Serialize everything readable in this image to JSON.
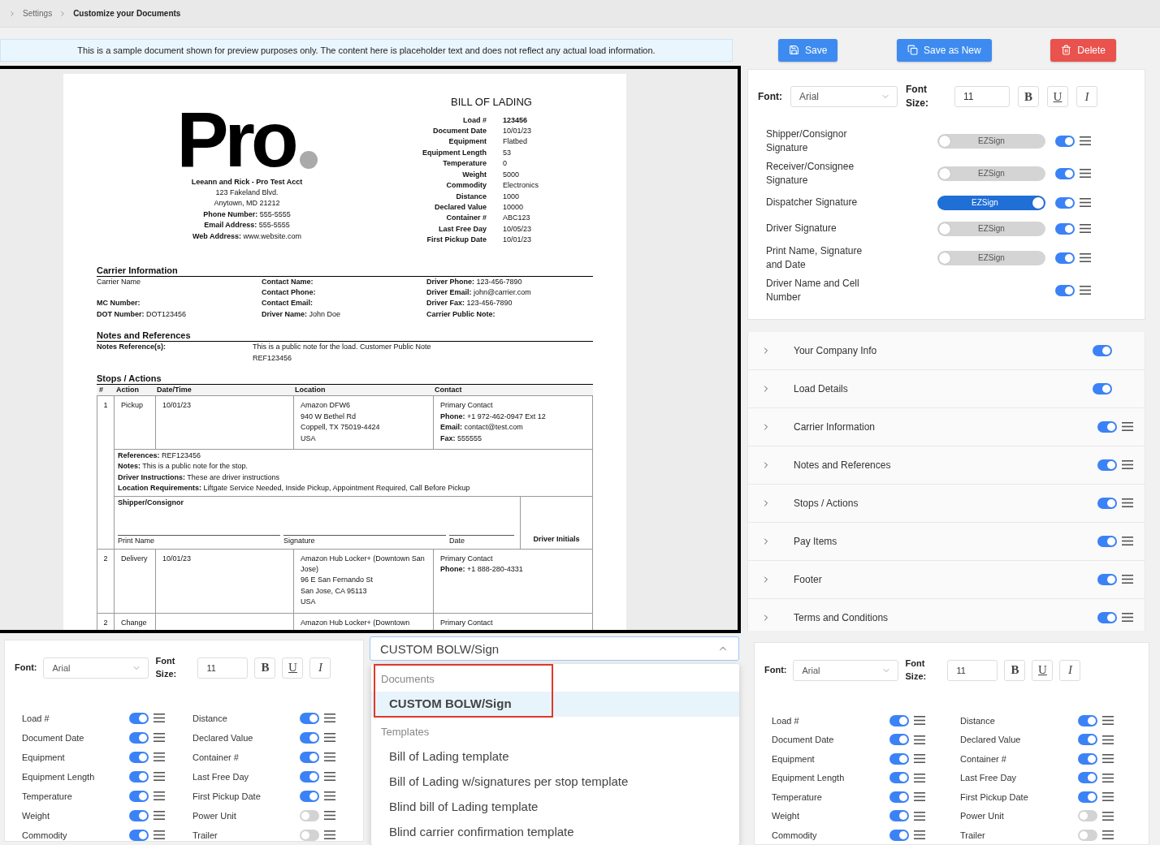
{
  "breadcrumb": [
    {
      "label": "Settings",
      "current": false
    },
    {
      "label": "Customize your Documents",
      "current": true
    }
  ],
  "notice": "This is a sample document shown for preview purposes only. The content here is placeholder text and does not reflect any actual load information.",
  "document": {
    "logo": "Pro",
    "company": {
      "name": "Leeann and Rick - Pro Test Acct",
      "lines": [
        "123 Fakeland Blvd.",
        "Anytown, MD 21212",
        "**Phone Number:** 555-5555",
        "**Email Address:** 555-5555",
        "**Web Address:** www.website.com"
      ]
    },
    "title": "BILL OF LADING",
    "details": [
      {
        "label": "Load #",
        "value": "123456",
        "bold": true
      },
      {
        "label": "Document Date",
        "value": "10/01/23",
        "bold": false
      },
      {
        "label": "Equipment",
        "value": "Flatbed",
        "bold": false
      },
      {
        "label": "Equipment Length",
        "value": "53",
        "bold": false
      },
      {
        "label": "Temperature",
        "value": "0",
        "bold": false
      },
      {
        "label": "Weight",
        "value": "5000",
        "bold": false
      },
      {
        "label": "Commodity",
        "value": "Electronics",
        "bold": false
      },
      {
        "label": "Distance",
        "value": "1000",
        "bold": false
      },
      {
        "label": "Declared Value",
        "value": "10000",
        "bold": false
      },
      {
        "label": "Container #",
        "value": "ABC123",
        "bold": false
      },
      {
        "label": "Last Free Day",
        "value": "10/05/23",
        "bold": false
      },
      {
        "label": "First Pickup Date",
        "value": "10/01/23",
        "bold": false
      }
    ],
    "carrier": {
      "title": "Carrier Information",
      "rows": [
        [
          "Carrier Name",
          "**Contact Name:**",
          "**Driver Phone:** 123-456-7890"
        ],
        [
          null,
          "**Contact Phone:**",
          "**Driver Email:** john@carrier.com"
        ],
        [
          "**MC Number:**",
          "**Contact Email:**",
          "**Driver Fax:** 123-456-7890"
        ],
        [
          "**DOT Number:** DOT123456",
          "**Driver Name:** John Doe",
          "**Carrier Public Note:**"
        ]
      ]
    },
    "notes": {
      "title": "Notes and References",
      "label": "Notes Reference(s):",
      "lines": [
        "This is a public note for the load. Customer Public Note",
        "REF123456"
      ]
    },
    "stops": {
      "title": "Stops / Actions",
      "columns": [
        "#",
        "Action",
        "Date/Time",
        "Location",
        "Contact"
      ],
      "rows": [
        {
          "number": "1",
          "action": "Pickup",
          "date": "10/01/23",
          "location": [
            "Amazon DFW6",
            "940 W Bethel Rd",
            "Coppell, TX 75019-4424",
            "USA"
          ],
          "contact": [
            "Primary Contact",
            "**Phone:** +1 972-462-0947 Ext 12",
            "**Email:** contact@test.com",
            "**Fax:** 555555"
          ],
          "details": [
            "**References:** REF123456",
            "**Notes:** This is a public note for the stop.",
            "**Driver Instructions:** These are driver instructions",
            "**Location Requirements:** Liftgate Service Needed, Inside Pickup, Appointment Required, Call Before Pickup"
          ],
          "signature": {
            "title": "Shipper/Consignor",
            "lines": [
              "Print Name",
              "Signature",
              "Date"
            ],
            "initials": "Driver Initials"
          }
        },
        {
          "number": "2",
          "action": "Delivery",
          "date": "10/01/23",
          "location": [
            "Amazon Hub Locker+ (Downtown San Jose)",
            "96 E San Fernando St",
            "San Jose, CA 95113",
            "USA"
          ],
          "contact": [
            "Primary Contact",
            "**Phone:** +1 888-280-4331"
          ]
        },
        {
          "number": "2",
          "action": "Change",
          "location": [
            "Amazon Hub Locker+ (Downtown"
          ],
          "contact": [
            "Primary Contact"
          ]
        }
      ]
    }
  },
  "actions": [
    {
      "label": "Save",
      "kind": "save"
    },
    {
      "label": "Save as New",
      "kind": "copy"
    },
    {
      "label": "Delete",
      "kind": "delete"
    }
  ],
  "signature_panel": {
    "toolbar": {
      "font_label": "Font:",
      "font": "Arial",
      "size_label": "Font Size:",
      "size": "11",
      "styles": [
        {
          "label": "B",
          "kind": "bold"
        },
        {
          "label": "U",
          "kind": "underline"
        },
        {
          "label": "I",
          "kind": "italic"
        }
      ]
    },
    "rows": [
      {
        "label": "Shipper/Consignor Signature",
        "ezsign": {
          "label": "EZSign",
          "on": false
        },
        "on": true
      },
      {
        "label": "Receiver/Consignee Signature",
        "ezsign": {
          "label": "EZSign",
          "on": false
        },
        "on": true
      },
      {
        "label": "Dispatcher Signature",
        "ezsign": {
          "label": "EZSign",
          "on": true
        },
        "on": true
      },
      {
        "label": "Driver Signature",
        "ezsign": {
          "label": "EZSign",
          "on": false
        },
        "on": true
      },
      {
        "label": "Print Name, Signature and Date",
        "ezsign": {
          "label": "EZSign",
          "on": false
        },
        "on": true
      },
      {
        "label": "Driver Name and Cell Number",
        "on": true
      }
    ]
  },
  "sections": [
    {
      "label": "Your Company Info",
      "on": true,
      "draggable": false
    },
    {
      "label": "Load Details",
      "on": true,
      "draggable": false
    },
    {
      "label": "Carrier Information",
      "on": true,
      "draggable": true
    },
    {
      "label": "Notes and References",
      "on": true,
      "draggable": true
    },
    {
      "label": "Stops / Actions",
      "on": true,
      "draggable": true
    },
    {
      "label": "Pay Items",
      "on": true,
      "draggable": true
    },
    {
      "label": "Footer",
      "on": true,
      "draggable": true
    },
    {
      "label": "Terms and Conditions",
      "on": true,
      "draggable": true
    }
  ],
  "left_fields_panel": {
    "toolbar": {
      "font_label": "Font:",
      "font": "Arial",
      "size_label": "Font Size:",
      "size": "11",
      "styles": [
        {
          "label": "B",
          "kind": "bold"
        },
        {
          "label": "U",
          "kind": "underline"
        },
        {
          "label": "I",
          "kind": "italic"
        }
      ]
    },
    "columns": [
      [
        {
          "label": "Load #",
          "on": true
        },
        {
          "label": "Document Date",
          "on": true
        },
        {
          "label": "Equipment",
          "on": true
        },
        {
          "label": "Equipment Length",
          "on": true
        },
        {
          "label": "Temperature",
          "on": true
        },
        {
          "label": "Weight",
          "on": true
        },
        {
          "label": "Commodity",
          "on": true
        }
      ],
      [
        {
          "label": "Distance",
          "on": true
        },
        {
          "label": "Declared Value",
          "on": true
        },
        {
          "label": "Container #",
          "on": true
        },
        {
          "label": "Last Free Day",
          "on": true
        },
        {
          "label": "First Pickup Date",
          "on": true
        },
        {
          "label": "Power Unit",
          "on": false
        },
        {
          "label": "Trailer",
          "on": false
        }
      ]
    ]
  },
  "template_picker": {
    "value": "CUSTOM BOLW/Sign",
    "expanded": true,
    "groups": [
      {
        "label": "Documents",
        "highlighted": true,
        "options": [
          {
            "label": "CUSTOM BOLW/Sign",
            "selected": true
          }
        ]
      },
      {
        "label": "Templates",
        "highlighted": false,
        "options": [
          {
            "label": "Bill of Lading template",
            "selected": false
          },
          {
            "label": "Bill of Lading w/signatures per stop template",
            "selected": false
          },
          {
            "label": "Blind bill of Lading template",
            "selected": false
          },
          {
            "label": "Blind carrier confirmation template",
            "selected": false
          }
        ]
      }
    ]
  },
  "right_fields_panel": {
    "toolbar": {
      "font_label": "Font:",
      "font": "Arial",
      "size_label": "Font Size:",
      "size": "11",
      "styles": [
        {
          "label": "B",
          "kind": "bold"
        },
        {
          "label": "U",
          "kind": "underline"
        },
        {
          "label": "I",
          "kind": "italic"
        }
      ]
    },
    "columns": [
      [
        {
          "label": "Load #",
          "on": true
        },
        {
          "label": "Document Date",
          "on": true
        },
        {
          "label": "Equipment",
          "on": true
        },
        {
          "label": "Equipment Length",
          "on": true
        },
        {
          "label": "Temperature",
          "on": true
        },
        {
          "label": "Weight",
          "on": true
        },
        {
          "label": "Commodity",
          "on": true
        }
      ],
      [
        {
          "label": "Distance",
          "on": true
        },
        {
          "label": "Declared Value",
          "on": true
        },
        {
          "label": "Container #",
          "on": true
        },
        {
          "label": "Last Free Day",
          "on": true
        },
        {
          "label": "First Pickup Date",
          "on": true
        },
        {
          "label": "Power Unit",
          "on": false
        },
        {
          "label": "Trailer",
          "on": false
        }
      ]
    ]
  }
}
